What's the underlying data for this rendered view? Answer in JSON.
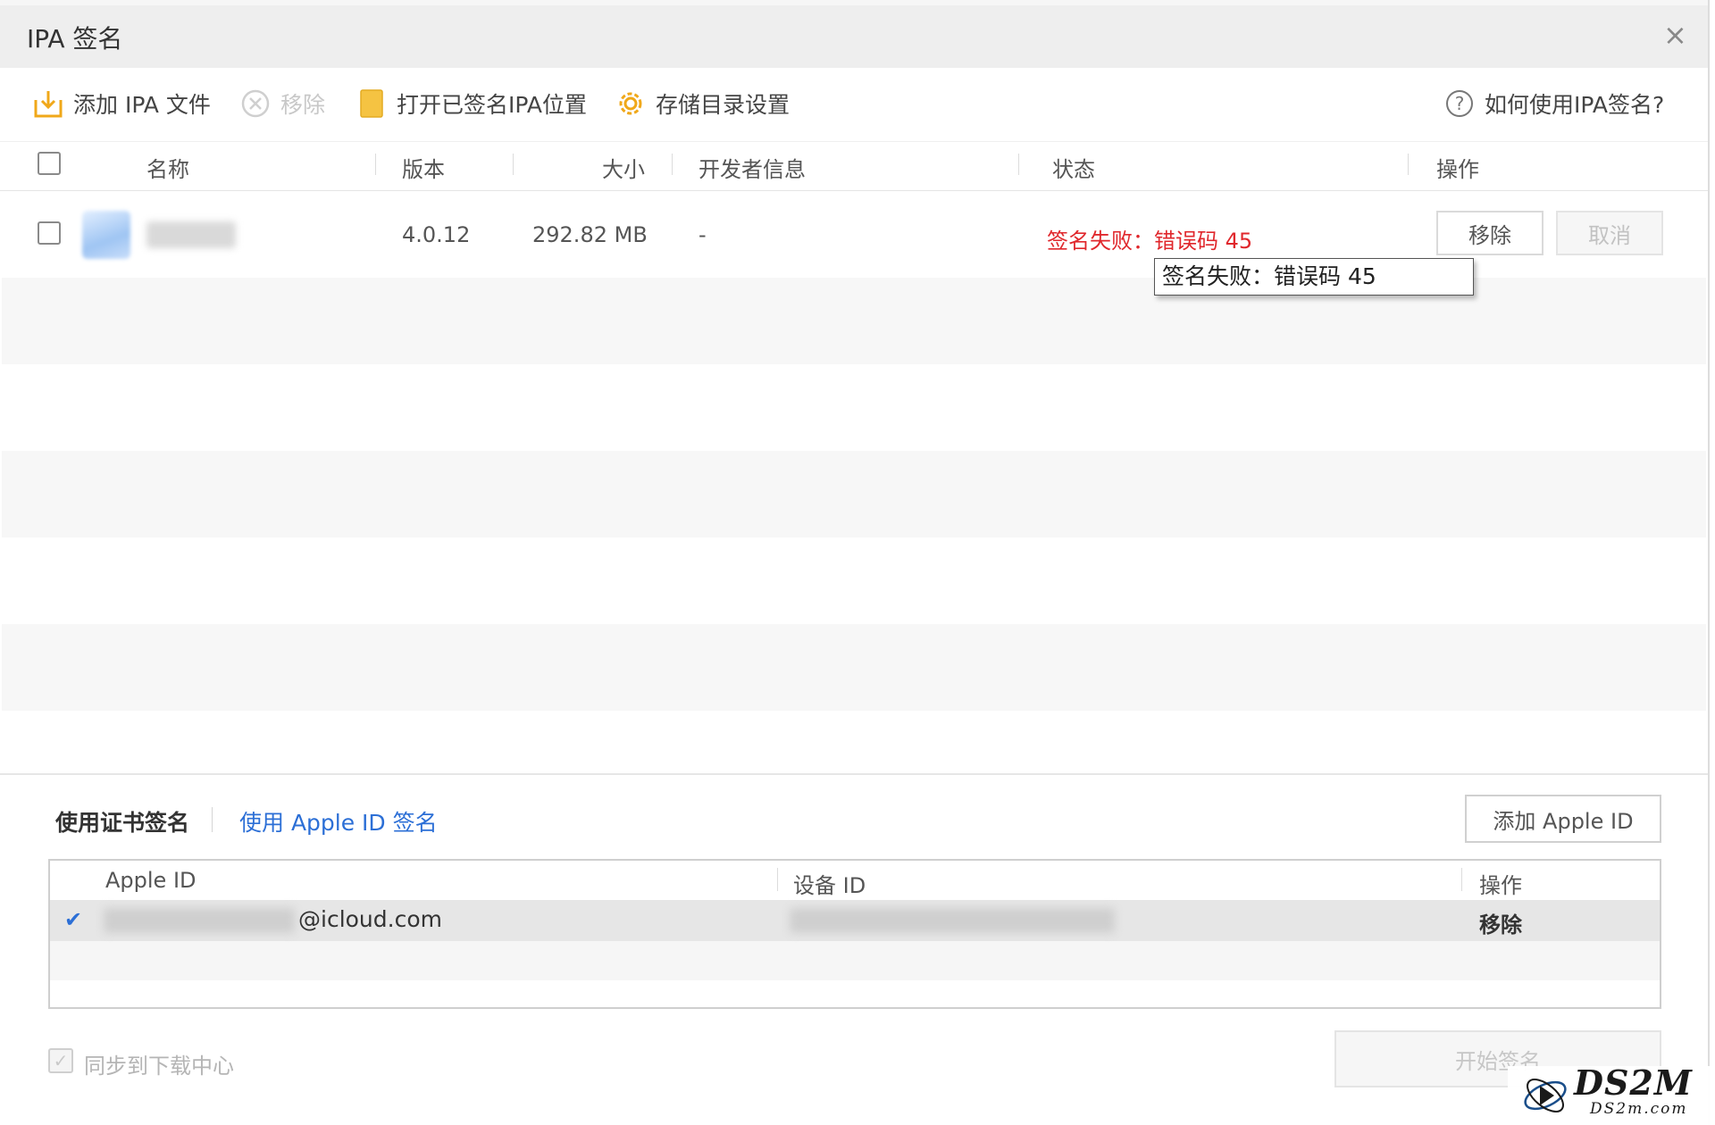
{
  "window": {
    "title": "IPA 签名",
    "close_glyph": "×"
  },
  "toolbar": {
    "add_ipa": "添加 IPA 文件",
    "remove": "移除",
    "open_signed_location": "打开已签名IPA位置",
    "storage_settings": "存储目录设置",
    "help": "如何使用IPA签名?"
  },
  "table": {
    "headers": {
      "name": "名称",
      "version": "版本",
      "size": "大小",
      "developer": "开发者信息",
      "status": "状态",
      "actions": "操作"
    },
    "rows": [
      {
        "version": "4.0.12",
        "size": "292.82 MB",
        "developer": "-",
        "status": "签名失败：错误码 45",
        "remove_label": "移除",
        "cancel_label": "取消"
      }
    ],
    "tooltip": "签名失败：错误码 45"
  },
  "sign_panel": {
    "tab_certificate": "使用证书签名",
    "tab_apple_id": "使用 Apple ID 签名",
    "add_apple_id": "添加 Apple ID",
    "grid_headers": {
      "apple_id": "Apple ID",
      "device_id": "设备 ID",
      "actions": "操作"
    },
    "rows": [
      {
        "selected_mark": "✔",
        "apple_id_suffix": "@icloud.com",
        "action": "移除"
      }
    ],
    "sync_label": "同步到下载中心",
    "start_button": "开始签名"
  },
  "watermark": {
    "brand": "DS2M",
    "domain": "DS2m.com"
  },
  "colors": {
    "error": "#e0272c",
    "link": "#2c6fd6",
    "folder": "#f5c342",
    "gear": "#f0a81a"
  }
}
